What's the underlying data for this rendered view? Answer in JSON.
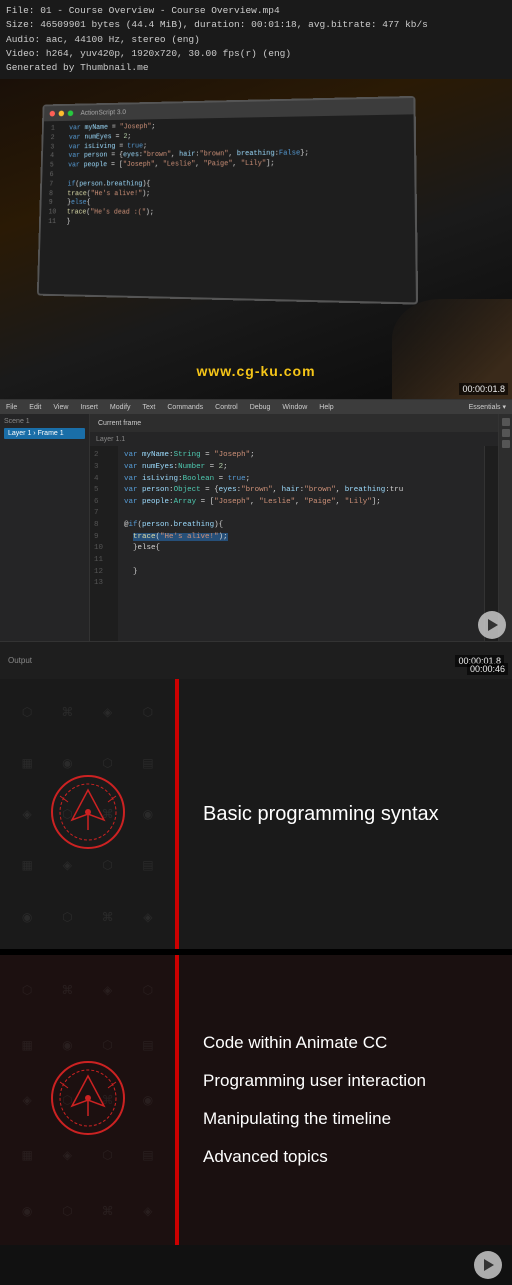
{
  "metadata": {
    "line1": "File: 01 - Course Overview - Course Overview.mp4",
    "line2": "Size: 46509901 bytes (44.4 MiB), duration: 00:01:18, avg.bitrate: 477 kb/s",
    "line3": "Audio: aac, 44100 Hz, stereo (eng)",
    "line4": "Video: h264, yuv420p, 1920x720, 30.00 fps(r) (eng)",
    "line5": "Generated by Thumbnail.me"
  },
  "toolbar_items": [
    "File",
    "Edit",
    "View",
    "Insert",
    "Modify",
    "Text",
    "Commands",
    "Control",
    "Debug",
    "Window",
    "Help"
  ],
  "watermark": "www.cg-ku.com",
  "timestamps": {
    "t1": "00:00:01.8",
    "t2": "00:00:01.8",
    "t3": "00:00:46"
  },
  "code_lines_top": [
    {
      "num": "1",
      "text": "var myName = \"Joseph\";"
    },
    {
      "num": "2",
      "text": "var numEyes = 2;"
    },
    {
      "num": "3",
      "text": "var isLiving = true;"
    },
    {
      "num": "4",
      "text": "var person = {eyes:\"brown\", hair:\"brown\", breathing:false};"
    },
    {
      "num": "5",
      "text": "var people = [\"Joseph\", \"Leslie\", \"Paige\", \"Lily\"];"
    },
    {
      "num": "6",
      "text": ""
    },
    {
      "num": "7",
      "text": "if(person.breathing){"
    },
    {
      "num": "8",
      "text": "  trace(\"He's alive!\");"
    },
    {
      "num": "9",
      "text": "}else{"
    },
    {
      "num": "10",
      "text": "  trace(\"He's dead :(\");"
    },
    {
      "num": "11",
      "text": "}"
    }
  ],
  "code_lines_editor": [
    {
      "num": "2",
      "text": "  var myName:String = \"Joseph\";"
    },
    {
      "num": "3",
      "text": "  var numEyes:Number = 2;"
    },
    {
      "num": "4",
      "text": "  var isLiving:Boolean = true;"
    },
    {
      "num": "5",
      "text": "  var person:Object = {eyes:\"brown\", hair:\"brown\", breathing:tru"
    },
    {
      "num": "6",
      "text": "  var people:Array = [\"Joseph\", \"Leslie\", \"Paige\", \"Lily\"];"
    },
    {
      "num": "7",
      "text": ""
    },
    {
      "num": "8",
      "text": "  @if(person.breathing){"
    },
    {
      "num": "9",
      "text": "    trace(\"He's alive!\");"
    },
    {
      "num": "10",
      "text": "  }else{"
    },
    {
      "num": "11",
      "text": ""
    },
    {
      "num": "12",
      "text": "  }"
    },
    {
      "num": "13",
      "text": ""
    }
  ],
  "course_sections": {
    "section1": {
      "title": "Basic programming syntax",
      "icon_label": "pen-nib-icon"
    },
    "section2": {
      "items": [
        {
          "label": "Code within Animate CC"
        },
        {
          "label": "Programming user interaction"
        },
        {
          "label": "Manipulating the timeline"
        },
        {
          "label": "Advanced topics"
        }
      ],
      "icon_label": "pen-nib-icon-2"
    }
  }
}
